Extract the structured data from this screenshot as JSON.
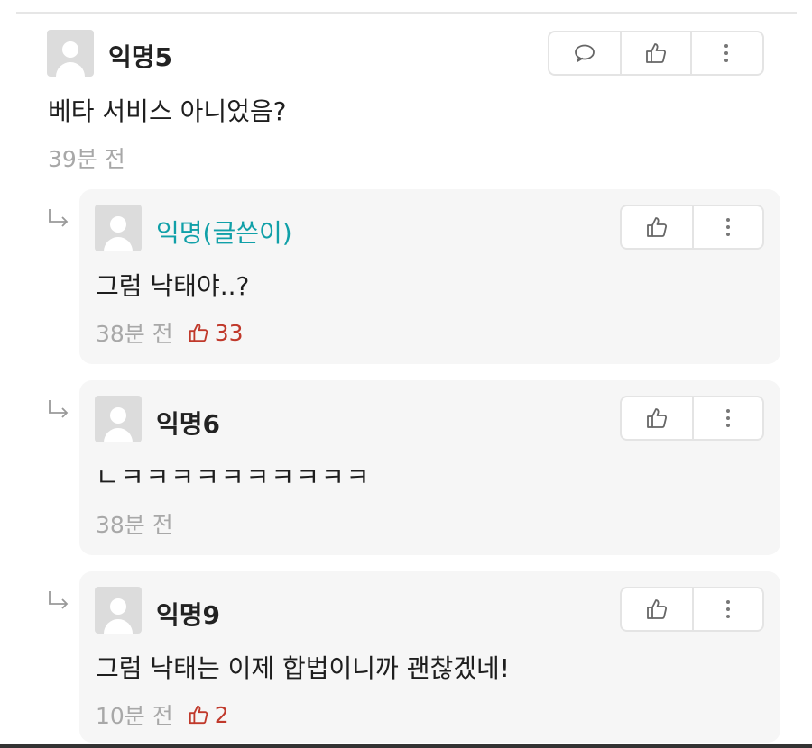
{
  "main_comment": {
    "author": "익명5",
    "text": "베타 서비스 아니었음?",
    "time": "39분 전",
    "actions": [
      "comment-icon",
      "thumbs-up-icon",
      "more-icon"
    ]
  },
  "replies": [
    {
      "author": "익명(글쓴이)",
      "text": "그럼 낙태야..?",
      "time": "38분 전",
      "votes": "33"
    },
    {
      "author": "익명6",
      "text": "ㄴㅋㅋㅋㅋㅋㅋㅋㅋㅋㅋ",
      "time": "38분 전",
      "votes": ""
    },
    {
      "author": "익명9",
      "text": "그럼 낙태는 이제 합법이니까 괜찮겠네!",
      "time": "10분 전",
      "votes": "2"
    }
  ],
  "colors": {
    "op_author": "#10a0a8",
    "vote": "#c0392b",
    "meta": "#a8a8a8",
    "card_bg": "#f6f6f6"
  }
}
